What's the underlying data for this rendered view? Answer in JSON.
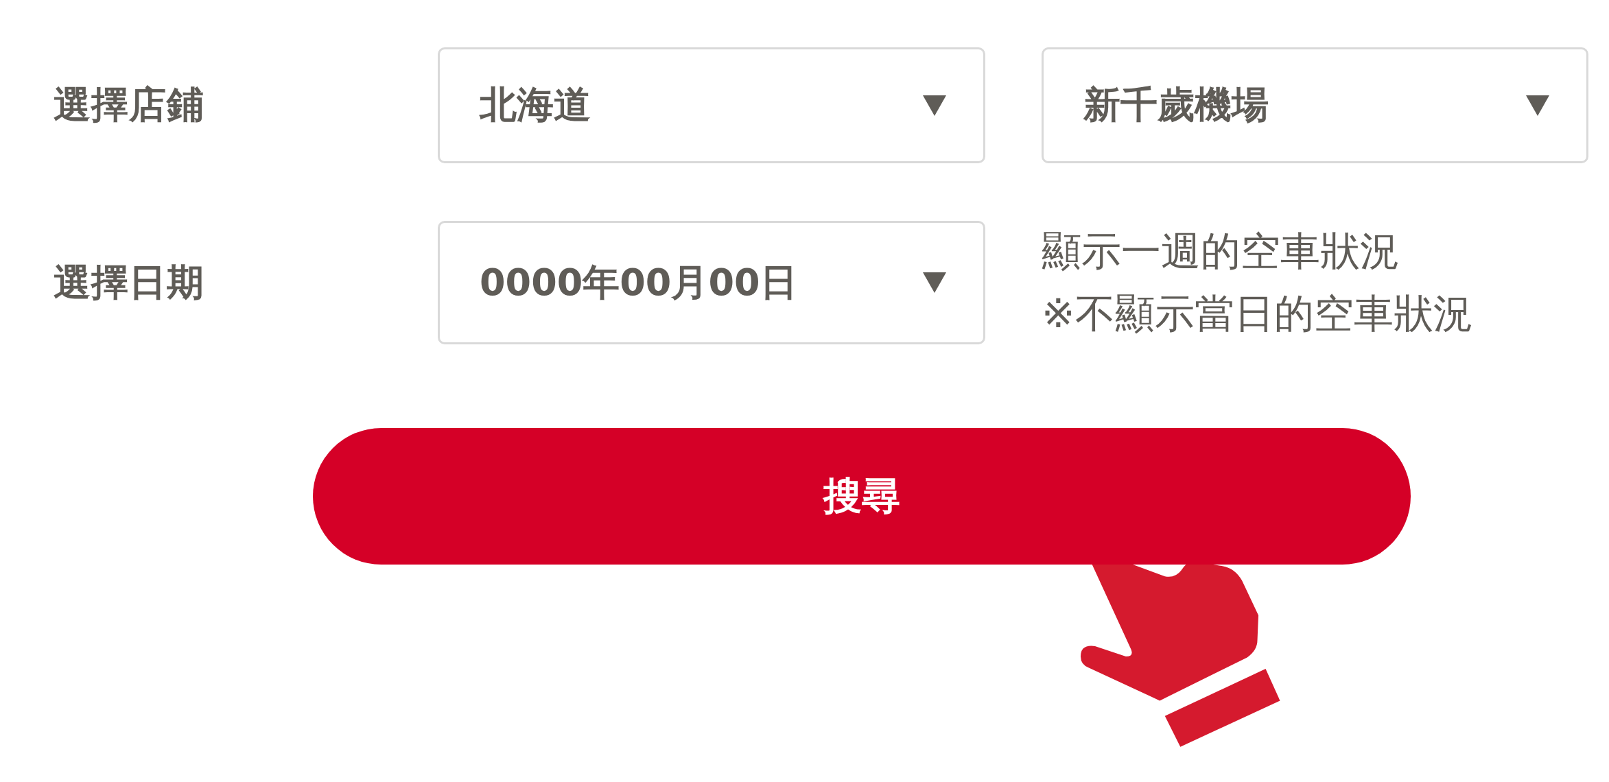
{
  "store_row": {
    "label": "選擇店鋪",
    "selects": [
      {
        "value": "北海道"
      },
      {
        "value": "新千歲機場"
      }
    ]
  },
  "date_row": {
    "label": "選擇日期",
    "select": {
      "value": "0000年00月00日"
    },
    "notes": [
      "顯示一週的空車狀況",
      "※不顯示當日的空車狀況"
    ]
  },
  "search_button": {
    "label": "搜尋"
  }
}
